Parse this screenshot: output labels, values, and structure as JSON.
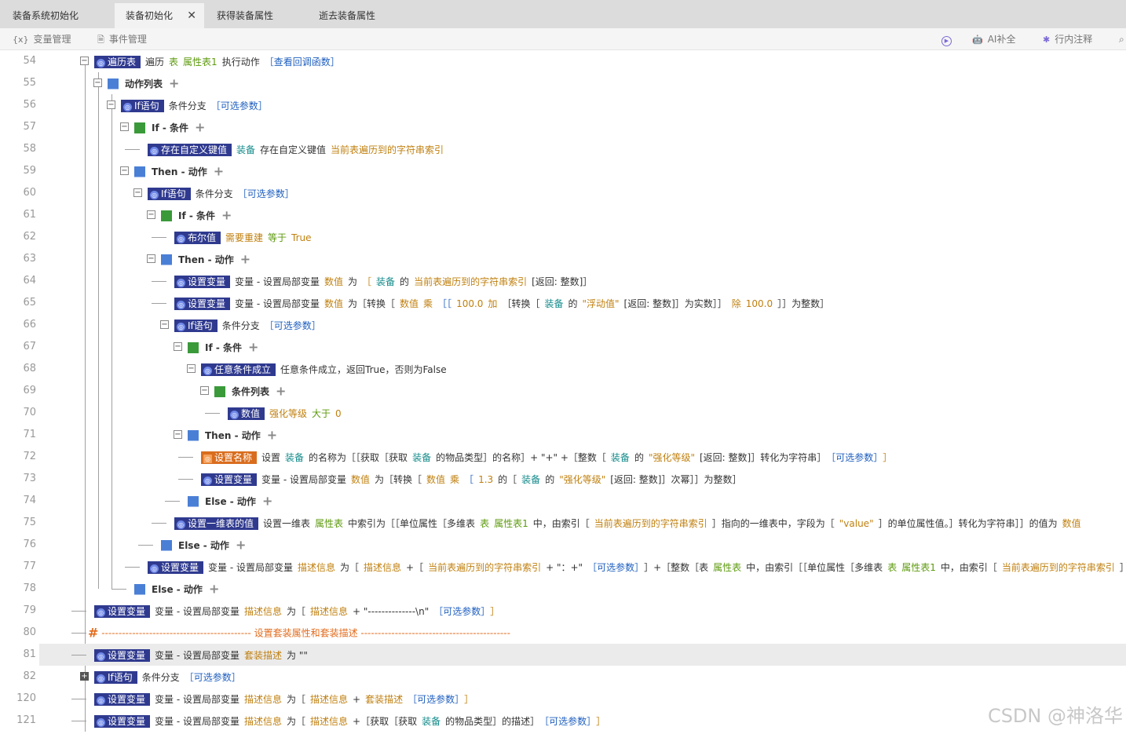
{
  "tabs": [
    {
      "label": "装备系统初始化"
    },
    {
      "label": "装备初始化",
      "close": "✕"
    },
    {
      "label": "获得装备属性"
    },
    {
      "label": "逝去装备属性"
    }
  ],
  "toolbar": {
    "var_icon": "{x}",
    "var_manage": "变量管理",
    "event_manage": "事件管理",
    "ai_complete": "AI补全",
    "line_comment": "行内注释"
  },
  "line_numbers": [
    "54",
    "55",
    "56",
    "57",
    "58",
    "59",
    "60",
    "61",
    "62",
    "63",
    "64",
    "65",
    "66",
    "67",
    "68",
    "69",
    "70",
    "71",
    "72",
    "73",
    "74",
    "75",
    "76",
    "77",
    "78",
    "79",
    "80",
    "81",
    "82",
    "120",
    "121"
  ],
  "rows": [
    {
      "pill": "遍历表",
      "parts": [
        [
          "遍历",
          "k"
        ],
        [
          "表",
          "g"
        ],
        [
          "属性表1",
          "g"
        ],
        [
          "执行动作",
          "k"
        ],
        [
          "［查看回调函数］",
          "br"
        ]
      ]
    },
    {
      "section": "动作列表",
      "icon": "blue"
    },
    {
      "pill": "If语句",
      "parts": [
        [
          "条件分支",
          "k"
        ],
        [
          "［可选参数］",
          "br"
        ]
      ]
    },
    {
      "section": "If - 条件",
      "icon": "green"
    },
    {
      "pill": "存在自定义键值",
      "parts": [
        [
          "装备",
          "t"
        ],
        [
          "存在自定义键值",
          "k"
        ],
        [
          "当前表遍历到的字符串索引",
          "o"
        ]
      ]
    },
    {
      "section": "Then - 动作",
      "icon": "blue"
    },
    {
      "pill": "If语句",
      "parts": [
        [
          "条件分支",
          "k"
        ],
        [
          "［可选参数］",
          "br"
        ]
      ]
    },
    {
      "section": "If - 条件",
      "icon": "green"
    },
    {
      "pill": "布尔值",
      "parts": [
        [
          "需要重建",
          "o"
        ],
        [
          "等于",
          "g"
        ],
        [
          "True",
          "o"
        ]
      ]
    },
    {
      "section": "Then - 动作",
      "icon": "blue"
    },
    {
      "pill": "设置变量",
      "parts": [
        [
          "变量 - 设置局部变量",
          "k"
        ],
        [
          "数值",
          "o"
        ],
        [
          "为",
          "k"
        ],
        [
          "［",
          "o"
        ],
        [
          "装备",
          "t"
        ],
        [
          "的",
          "k"
        ],
        [
          "当前表遍历到的字符串索引",
          "o"
        ],
        [
          "[返回: 整数]］",
          "k"
        ]
      ]
    },
    {
      "pill": "设置变量",
      "parts": [
        [
          "变量 - 设置局部变量",
          "k"
        ],
        [
          "数值",
          "o"
        ],
        [
          "为［转换［",
          "k"
        ],
        [
          "数值",
          "o"
        ],
        [
          "乘",
          "o"
        ],
        [
          "［［",
          "br"
        ],
        [
          "100.0",
          "o"
        ],
        [
          "加",
          "o"
        ],
        [
          "［转换［",
          "k"
        ],
        [
          "装备",
          "t"
        ],
        [
          "的",
          "k"
        ],
        [
          "\"浮动值\"",
          "o"
        ],
        [
          "[返回: 整数]］为实数］］",
          "k"
        ],
        [
          "除",
          "o"
        ],
        [
          "100.0",
          "o"
        ],
        [
          "］］为整数］",
          "k"
        ]
      ]
    },
    {
      "pill": "If语句",
      "parts": [
        [
          "条件分支",
          "k"
        ],
        [
          "［可选参数］",
          "br"
        ]
      ]
    },
    {
      "section": "If - 条件",
      "icon": "green"
    },
    {
      "pill": "任意条件成立",
      "parts": [
        [
          "任意条件成立，返回True，否则为False",
          "k"
        ]
      ]
    },
    {
      "section": "条件列表",
      "icon": "green"
    },
    {
      "pill": "数值",
      "parts": [
        [
          "强化等级",
          "o"
        ],
        [
          "大于",
          "g"
        ],
        [
          "0",
          "o"
        ]
      ]
    },
    {
      "section": "Then - 动作",
      "icon": "blue"
    },
    {
      "pill": "设置名称",
      "pillStyle": "orange",
      "parts": [
        [
          "设置",
          "k"
        ],
        [
          "装备",
          "t"
        ],
        [
          "的名称为［［获取［获取",
          "k"
        ],
        [
          "装备",
          "t"
        ],
        [
          "的物品类型］的名称］+ \"+\" +［整数［",
          "k"
        ],
        [
          "装备",
          "t"
        ],
        [
          "的",
          "k"
        ],
        [
          "\"强化等级\"",
          "o"
        ],
        [
          "[返回: 整数]］转化为字符串］",
          "k"
        ],
        [
          "［可选参数］",
          "br"
        ],
        [
          "］",
          "o"
        ]
      ]
    },
    {
      "pill": "设置变量",
      "parts": [
        [
          "变量 - 设置局部变量",
          "k"
        ],
        [
          "数值",
          "o"
        ],
        [
          "为［转换［",
          "k"
        ],
        [
          "数值",
          "o"
        ],
        [
          "乘",
          "o"
        ],
        [
          "［",
          "br"
        ],
        [
          "1.3",
          "o"
        ],
        [
          "的［",
          "k"
        ],
        [
          "装备",
          "t"
        ],
        [
          "的",
          "k"
        ],
        [
          "\"强化等级\"",
          "o"
        ],
        [
          "[返回: 整数]］次幂］］为整数］",
          "k"
        ]
      ]
    },
    {
      "section": "Else - 动作",
      "icon": "blue"
    },
    {
      "pill": "设置一维表的值",
      "parts": [
        [
          "设置一维表",
          "k"
        ],
        [
          "属性表",
          "g"
        ],
        [
          "中索引为［［单位属性［多维表",
          "k"
        ],
        [
          "表",
          "g"
        ],
        [
          "属性表1",
          "g"
        ],
        [
          "中，由索引［",
          "k"
        ],
        [
          "当前表遍历到的字符串索引",
          "o"
        ],
        [
          "］指向的一维表中，字段为［",
          "k"
        ],
        [
          "\"value\"",
          "o"
        ],
        [
          "］的单位属性值。］转化为字符串］］的值为",
          "k"
        ],
        [
          "数值",
          "o"
        ]
      ]
    },
    {
      "section": "Else - 动作",
      "icon": "blue"
    },
    {
      "pill": "设置变量",
      "parts": [
        [
          "变量 - 设置局部变量",
          "k"
        ],
        [
          "描述信息",
          "o"
        ],
        [
          "为［",
          "k"
        ],
        [
          "描述信息",
          "o"
        ],
        [
          "+［",
          "k"
        ],
        [
          "当前表遍历到的字符串索引",
          "o"
        ],
        [
          "+ \"：+\"",
          "k"
        ],
        [
          "［可选参数］",
          "br"
        ],
        [
          "］+［整数［表",
          "k"
        ],
        [
          "属性表",
          "g"
        ],
        [
          "中，由索引［［单位属性［多维表",
          "k"
        ],
        [
          "表",
          "g"
        ],
        [
          "属性表1",
          "g"
        ],
        [
          "中，由索引［",
          "k"
        ],
        [
          "当前表遍历到的字符串索引",
          "o"
        ],
        [
          "］",
          "k"
        ]
      ]
    },
    {
      "section": "Else - 动作",
      "icon": "blue"
    },
    {
      "pill": "设置变量",
      "parts": [
        [
          "变量 - 设置局部变量",
          "k"
        ],
        [
          "描述信息",
          "o"
        ],
        [
          "为［",
          "k"
        ],
        [
          "描述信息",
          "o"
        ],
        [
          "+ \"--------------\\n\"",
          "k"
        ],
        [
          "［可选参数］",
          "br"
        ],
        [
          "］",
          "o"
        ]
      ]
    },
    {
      "comment": "设置套装属性和套装描述"
    },
    {
      "pill": "设置变量",
      "parts": [
        [
          "变量 - 设置局部变量",
          "k"
        ],
        [
          "套装描述",
          "o"
        ],
        [
          "为 \"\"",
          "k"
        ]
      ]
    },
    {
      "pill": "If语句",
      "parts": [
        [
          "条件分支",
          "k"
        ],
        [
          "［可选参数］",
          "br"
        ]
      ]
    },
    {
      "pill": "设置变量",
      "parts": [
        [
          "变量 - 设置局部变量",
          "k"
        ],
        [
          "描述信息",
          "o"
        ],
        [
          "为［",
          "k"
        ],
        [
          "描述信息",
          "o"
        ],
        [
          "+",
          "k"
        ],
        [
          "套装描述",
          "o"
        ],
        [
          "［可选参数］",
          "br"
        ],
        [
          "］",
          "o"
        ]
      ]
    },
    {
      "pill": "设置变量",
      "parts": [
        [
          "变量 - 设置局部变量",
          "k"
        ],
        [
          "描述信息",
          "o"
        ],
        [
          "为［",
          "k"
        ],
        [
          "描述信息",
          "o"
        ],
        [
          "+［获取［获取",
          "k"
        ],
        [
          "装备",
          "t"
        ],
        [
          "的物品类型］的描述］",
          "k"
        ],
        [
          "［可选参数］",
          "br"
        ],
        [
          "］",
          "o"
        ]
      ]
    }
  ],
  "watermark": "CSDN @神洛华"
}
